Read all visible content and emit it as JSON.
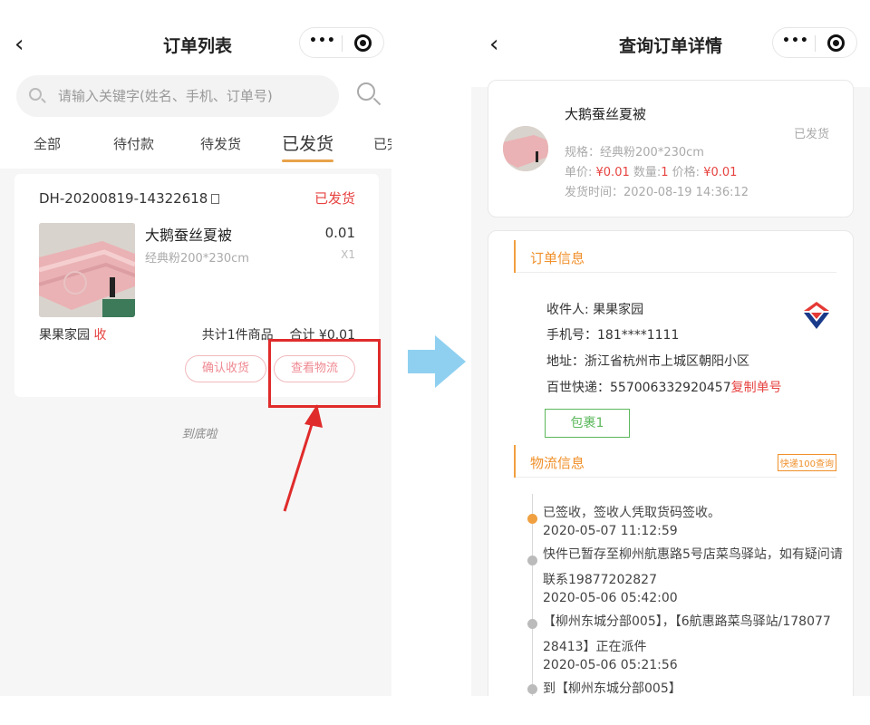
{
  "left": {
    "nav_title": "订单列表",
    "back": "‹",
    "search_placeholder": "请输入关键字(姓名、手机、订单号)",
    "tabs": [
      "全部",
      "待付款",
      "待发货",
      "已发货",
      "已完"
    ],
    "order": {
      "number": "DH-20200819-14322618",
      "status": "已发货",
      "product_title": "大鹅蚕丝夏被",
      "product_spec": "经典粉200*230cm",
      "price": "0.01",
      "qty": "X1",
      "buyer_name": "果果家园",
      "buyer_tag": "收",
      "summary": "共计1件商品    合计 ¥0.01",
      "btn_confirm": "确认收货",
      "btn_logistics": "查看物流"
    },
    "bottom_tip": "到底啦"
  },
  "right": {
    "nav_title": "查询订单详情",
    "back": "‹",
    "product": {
      "title": "大鹅蚕丝夏被",
      "status": "已发货",
      "spec": "规格：经典粉200*230cm",
      "unit_price_label": "单价: ",
      "unit_price": "¥0.01",
      "qty_label": " 数量:",
      "qty": "1",
      "total_label": " 价格: ",
      "total": "¥0.01",
      "ship_time": "发货时间：2020-08-19 14:36:12"
    },
    "order_info": {
      "title": "订单信息",
      "receiver": "收件人: 果果家园",
      "phone": "手机号：181****1111",
      "address": "地址：浙江省杭州市上城区朝阳小区",
      "express": "百世快递：557006332920457",
      "copy": "复制单号",
      "package_btn": "包裹1"
    },
    "logistics": {
      "title": "物流信息",
      "tag": "快递100查询",
      "lines": [
        "已签收，签收人凭取货码签收。",
        "2020-05-07 11:12:59",
        "快件已暂存至柳州航惠路5号店菜鸟驿站，如有疑问请",
        "联系19877202827",
        "2020-05-06 05:42:00",
        "【柳州东城分部005】，【6航惠路菜鸟驿站/178077",
        "28413】正在派件",
        "2020-05-06 05:21:56",
        "到【柳州东城分部005】"
      ]
    }
  },
  "colors": {
    "accent_orange": "#f0902a",
    "status_red": "#e64340",
    "tab_underline": "#e8a34a",
    "arrow_blue": "#8fd0f0",
    "highlight_red": "#e02b2b",
    "package_green": "#5cb85c"
  }
}
